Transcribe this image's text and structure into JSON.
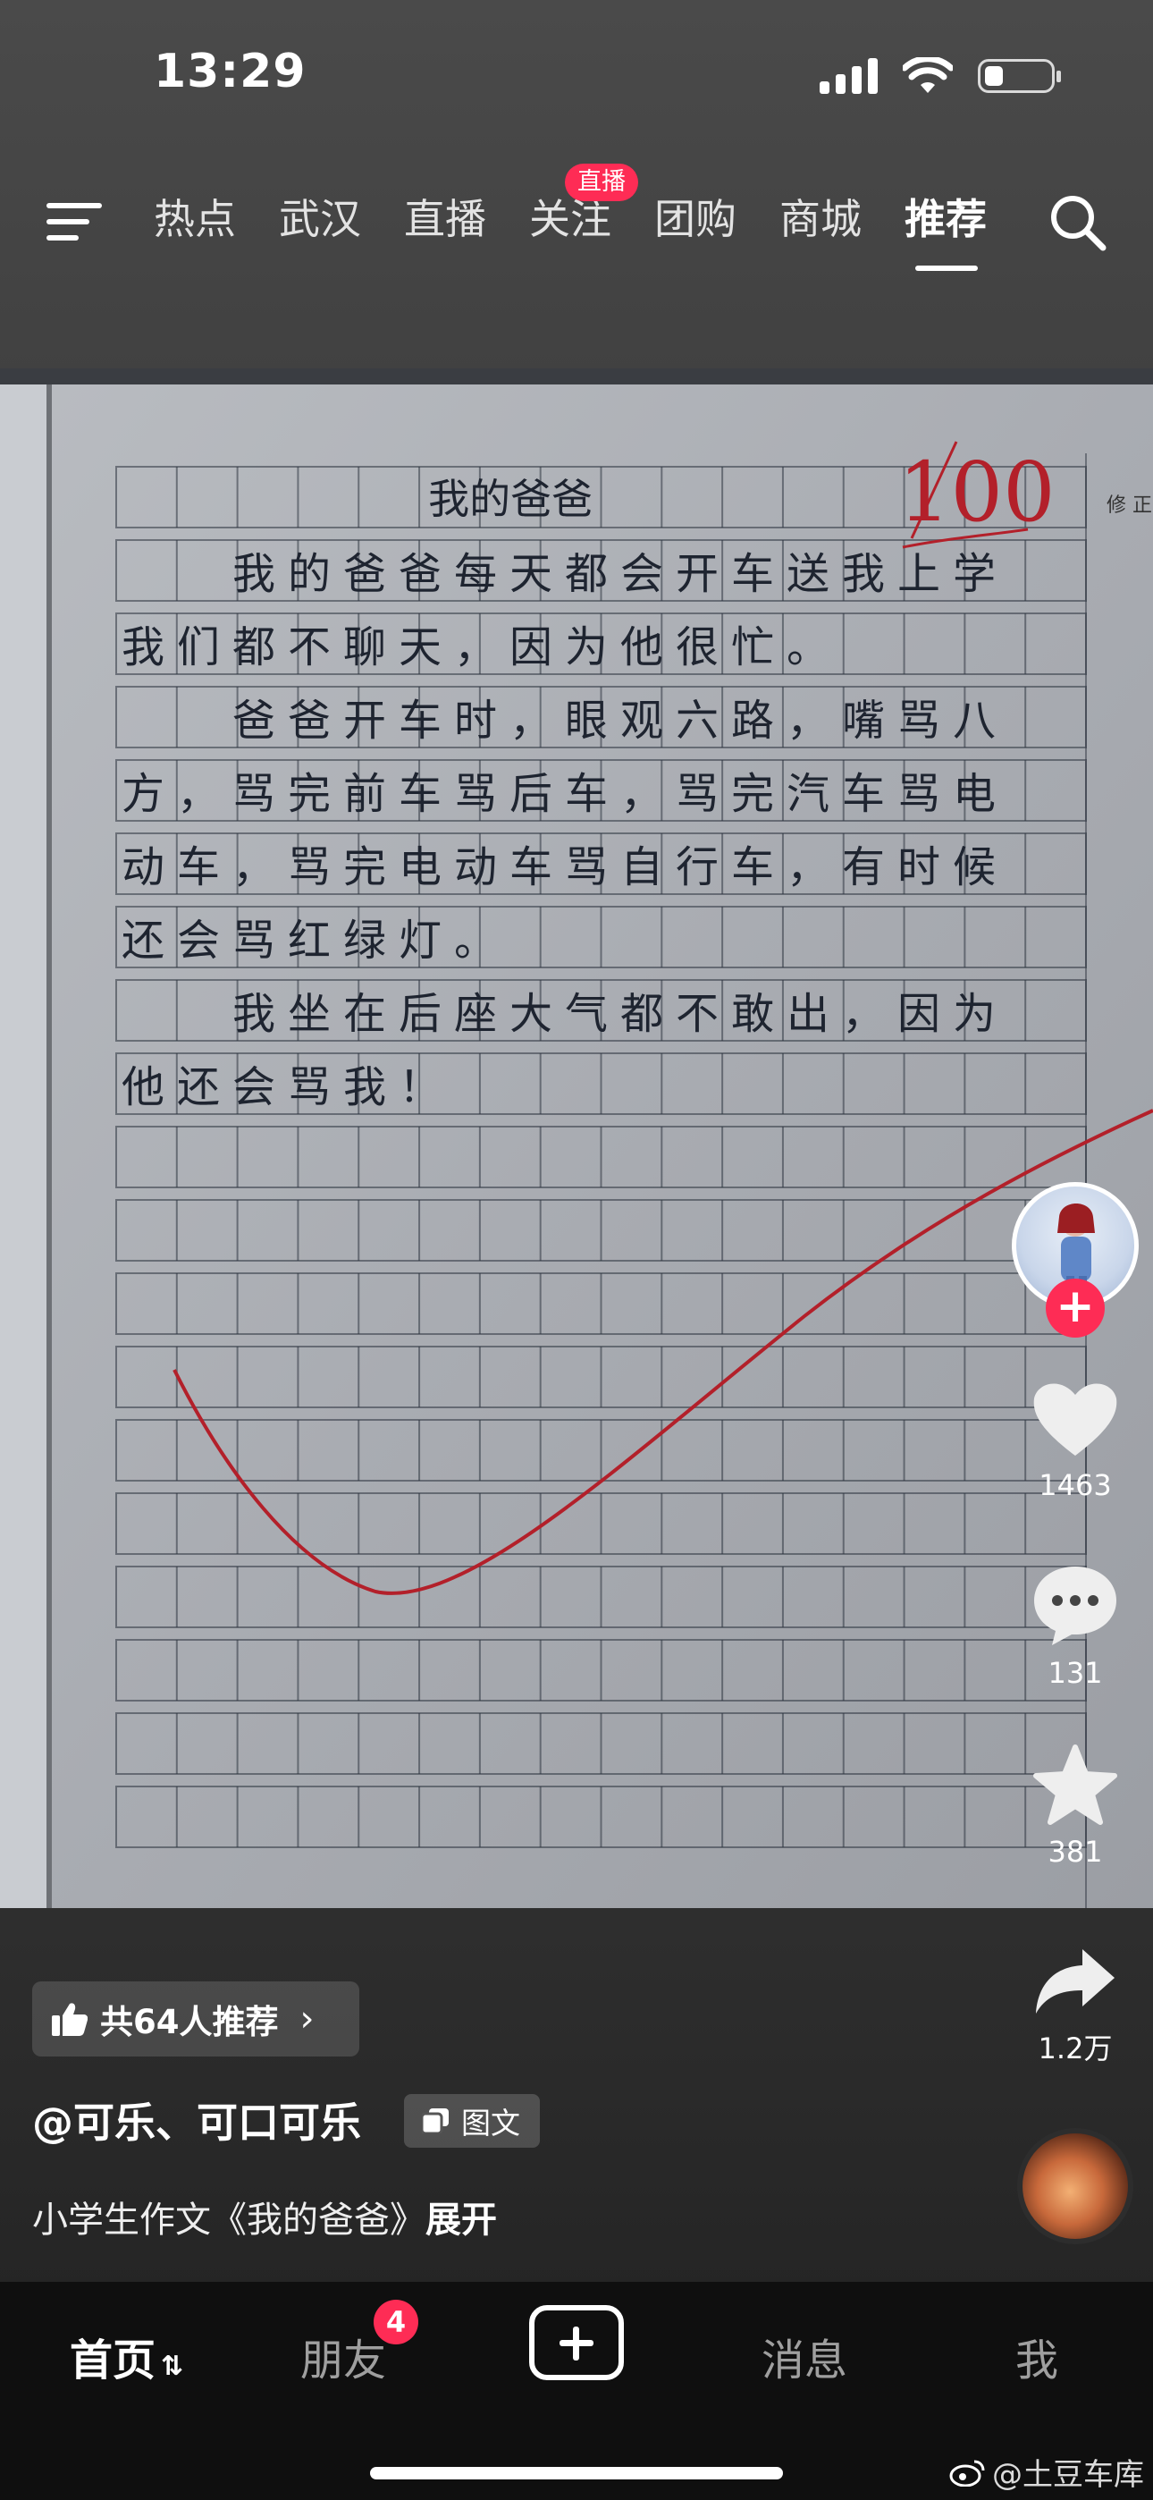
{
  "status": {
    "time": "13:29"
  },
  "nav": {
    "tabs": [
      "热点",
      "武汉",
      "直播",
      "关注",
      "团购",
      "商城",
      "推荐"
    ],
    "live_badge": "直播"
  },
  "post": {
    "recommend_text": "共64人推荐",
    "author": "@可乐、可口可乐",
    "tag": "图文",
    "description": "小学生作文《我的爸爸》",
    "expand": "展开",
    "essay": {
      "title": "我的爸爸",
      "score": "100",
      "corner_note": "修 正",
      "lines": [
        "　　我的爸爸每天都会开车送我上学",
        "我们都不聊天，因为他很忙。",
        "　　爸爸开车时，眼观六路，嘴骂八",
        "方，骂完前车骂后车，骂完汽车骂电",
        "动车，骂完电动车骂自行车，有时候",
        "还会骂红绿灯。",
        "　　我坐在后座大气都不敢出，因为",
        "他还会骂我！"
      ]
    }
  },
  "rail": {
    "likes": "1463",
    "comments": "131",
    "favorites": "381",
    "shares": "1.2万"
  },
  "bottom_nav": {
    "home": "首页",
    "friends": "朋友",
    "friends_badge": "4",
    "messages": "消息",
    "me": "我"
  },
  "watermark": "@土豆车库",
  "colors": {
    "accent": "#fe2c55",
    "ink": "#1e2430",
    "red_pen": "#b3202a"
  }
}
